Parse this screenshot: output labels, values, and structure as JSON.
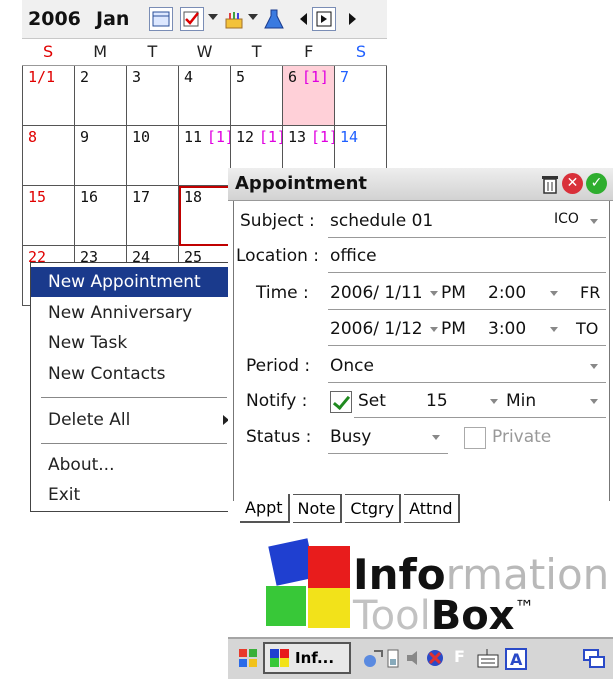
{
  "calendar": {
    "year": "2006",
    "month": "Jan",
    "toolbar_icons": [
      "calendar-icon",
      "task-check-icon",
      "cake-icon",
      "flask-icon",
      "prev-arrow-icon",
      "goto-icon",
      "next-arrow-icon"
    ],
    "weekdays": [
      "S",
      "M",
      "T",
      "W",
      "T",
      "F",
      "S"
    ],
    "weeks": [
      [
        {
          "d": "1/1"
        },
        {
          "d": "2"
        },
        {
          "d": "3"
        },
        {
          "d": "4"
        },
        {
          "d": "5"
        },
        {
          "d": "6",
          "ev": "[1]"
        },
        {
          "d": "7"
        }
      ],
      [
        {
          "d": "8"
        },
        {
          "d": "9"
        },
        {
          "d": "10"
        },
        {
          "d": "11",
          "ev": "[1]"
        },
        {
          "d": "12",
          "ev": "[1]"
        },
        {
          "d": "13",
          "ev": "[1]"
        },
        {
          "d": "14"
        }
      ],
      [
        {
          "d": "15"
        },
        {
          "d": "16"
        },
        {
          "d": "17"
        },
        {
          "d": "18"
        },
        {
          "d": ""
        },
        {
          "d": ""
        },
        {
          "d": ""
        }
      ],
      [
        {
          "d": "22"
        },
        {
          "d": "23"
        },
        {
          "d": "24"
        },
        {
          "d": "25"
        },
        {
          "d": ""
        },
        {
          "d": ""
        },
        {
          "d": ""
        }
      ]
    ],
    "colors": {
      "sunday": "#e00000",
      "saturday": "#2060ff",
      "event": "#e000e0",
      "today_bg": "#ffd0d8"
    }
  },
  "menu": {
    "items": [
      "New Appointment",
      "New Anniversary",
      "New Task",
      "New Contacts",
      "Delete All",
      "About...",
      "Exit"
    ],
    "highlight_color": "#1a3a8c"
  },
  "appointment": {
    "title": "Appointment",
    "subject_label": "Subject :",
    "subject_value": "schedule 01",
    "icon_select": "ICO",
    "location_label": "Location :",
    "location_value": "office",
    "time_label": "Time :",
    "start_date": "2006/ 1/11",
    "start_ampm": "PM",
    "start_time": "2:00",
    "start_tag": "FR",
    "end_date": "2006/ 1/12",
    "end_ampm": "PM",
    "end_time": "3:00",
    "end_tag": "TO",
    "period_label": "Period :",
    "period_value": "Once",
    "notify_label": "Notify :",
    "notify_set": "Set",
    "notify_amount": "15",
    "notify_unit": "Min",
    "status_label": "Status :",
    "status_value": "Busy",
    "private_label": "Private",
    "tabs": [
      "Appt",
      "Note",
      "Ctgry",
      "Attnd"
    ]
  },
  "logo": {
    "info_bold": "Info",
    "info_gray": "rmation",
    "tool": "Tool",
    "box": "Box",
    "tm": "™"
  },
  "taskbar": {
    "task_label": "Inf..."
  }
}
